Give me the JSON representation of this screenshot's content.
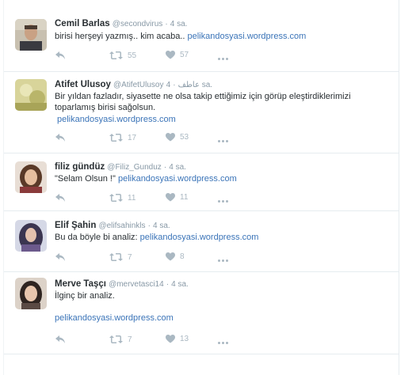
{
  "colors": {
    "link": "#3b74b8",
    "meta": "#8899a6",
    "action": "#aab8c2"
  },
  "icons": {
    "reply": "reply-arrow-icon",
    "retweet": "retweet-icon",
    "like": "heart-icon",
    "more": "more-dots-icon"
  },
  "tweets": [
    {
      "name": "Cemil Barlas",
      "handle": "@secondvirus",
      "separator": "·",
      "time": "4 sa.",
      "text": "birisi herşeyi yazmış.. kim acaba.. ",
      "link": "pelikandosyasi.wordpress.com",
      "retweets": "55",
      "likes": "57"
    },
    {
      "name": "Atifet Ulusoy",
      "handle": "@AtifetUlusoy",
      "handle_extra": "عاطف",
      "separator": "·",
      "time": "4 sa.",
      "text": "Bir yıldan fazladır, siyasette ne olsa takip ettiğimiz için görüp eleştirdiklerimizi toparlamış birisi sağolsun.",
      "link": "pelikandosyasi.wordpress.com",
      "retweets": "17",
      "likes": "53"
    },
    {
      "name": "filiz gündüz",
      "handle": "@Filiz_Gunduz",
      "separator": "·",
      "time": "4 sa.",
      "text": "\"Selam Olsun !\" ",
      "link": "pelikandosyasi.wordpress.com",
      "retweets": "11",
      "likes": "11"
    },
    {
      "name": "Elif Şahin",
      "handle": "@elifsahinkls",
      "separator": "·",
      "time": "4 sa.",
      "text": "Bu da böyle bi analiz: ",
      "link": "pelikandosyasi.wordpress.com",
      "retweets": "7",
      "likes": "8"
    },
    {
      "name": "Merve Taşçı",
      "handle": "@mervetasci14",
      "separator": "·",
      "time": "4 sa.",
      "text": "İlginç bir analiz.",
      "link": "pelikandosyasi.wordpress.com",
      "retweets": "7",
      "likes": "13"
    }
  ]
}
